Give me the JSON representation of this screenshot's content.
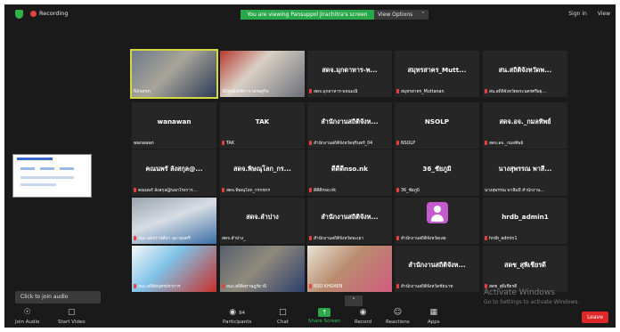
{
  "topbar": {
    "recording_label": "Recording",
    "viewing_banner": "You are viewing Pansuppol Jirachitra's screen",
    "view_options_label": "View Options",
    "view_options_chevron": "˅",
    "sign_in_label": "Sign in",
    "view_label": "View"
  },
  "tiles": [
    {
      "big": "",
      "label": "Ninaron",
      "has_mic_icon": false
    },
    {
      "big": "",
      "label": "30ศูนย์สถิติการ เศรษฐกิจ",
      "has_mic_icon": false
    },
    {
      "big": "สดจ.มุกดาหาร-พ...",
      "label": "สดจ.มุกดาหาร-พจนมณี",
      "has_mic_icon": true
    },
    {
      "big": "สมุทรสาคร_Mutt...",
      "label": "สมุทรสาคร_Muttanan",
      "has_mic_icon": true
    },
    {
      "big": "สน.สถิติจังหวัดพ...",
      "label": "สน.สถิติจังหวัดพระนครศรีอยุ...",
      "has_mic_icon": true
    },
    {
      "big": "wanawan",
      "label": "wanawan",
      "has_mic_icon": false
    },
    {
      "big": "TAK",
      "label": "TAK",
      "has_mic_icon": true
    },
    {
      "big": "สำนักงานสถิติจังห...",
      "label": "สำนักงานสถิติจังหวัดสุรินทร์_04",
      "has_mic_icon": true
    },
    {
      "big": "NSOLP",
      "label": "NSOLP",
      "has_mic_icon": true
    },
    {
      "big": "สดจ.อจ._กมลทิพย์",
      "label": "สดจ.อจ._กมลทิพย์",
      "has_mic_icon": true
    },
    {
      "big": "คณนพรั ลังสกุล@...",
      "label": "คณนพรั ลังสกุล@บอกโรงการ...",
      "has_mic_icon": true
    },
    {
      "big": "สดจ.พิษณุโลก_กร...",
      "label": "สดจ.พิษณุโลก_กรกชกร",
      "has_mic_icon": true
    },
    {
      "big": "ดีดีดีnso.nk",
      "label": "ดีดีดีnso.nk",
      "has_mic_icon": true
    },
    {
      "big": "36_ชัยภูมิ",
      "label": "36_ชัยภูมิ",
      "has_mic_icon": true
    },
    {
      "big": "นางสุพรรณ พาสี...",
      "label": "นางสุพรรณ พาสีมมี สำนักงาน...",
      "has_mic_icon": false
    },
    {
      "big": "",
      "label": "สนง.นครราชสีมา อุมาสุนทรี",
      "has_mic_icon": true
    },
    {
      "big": "สดจ.ลำปาง",
      "label": "สดจ.ลำปาง_",
      "has_mic_icon": false
    },
    {
      "big": "สำนักงานสถิติจังห...",
      "label": "สำนักงานสถิติจังหวัดพะเยา",
      "has_mic_icon": true
    },
    {
      "big": "",
      "label": "สำนักงานสถิติจังหวัดเลย",
      "has_mic_icon": true
    },
    {
      "big": "hrdb_admin1",
      "label": "hrdb_admin1",
      "has_mic_icon": true
    },
    {
      "big": "",
      "label": "สนง.สถิติสมุทรปราการ",
      "has_mic_icon": true
    },
    {
      "big": "",
      "label": "สนง.สถิติสุราษฎร์ธานี",
      "has_mic_icon": true
    },
    {
      "big": "",
      "label": "NSO KHOAEN",
      "has_mic_icon": true
    },
    {
      "big": "สำนักงานสถิติจังห...",
      "label": "สำนักงานสถิติจังหวัดชัยนาท",
      "has_mic_icon": true
    },
    {
      "big": "สดช_สุพิเชียรดี",
      "label": "สดช_สุพิเชียรดี",
      "has_mic_icon": true
    }
  ],
  "toast": "Click to join audio",
  "scroll_chevron": "˅",
  "toolbar": {
    "join_audio": "Join Audio",
    "start_video": "Start Video",
    "participants": "Participants",
    "participant_count": "94",
    "chat": "Chat",
    "share_screen": "Share Screen",
    "record": "Record",
    "reactions": "Reactions",
    "apps": "Apps",
    "leave": "Leave"
  },
  "watermark": {
    "line1": "Activate Windows",
    "line2": "Go to Settings to activate Windows."
  },
  "colors": {
    "background": "#1a1a1a",
    "tile": "#262626",
    "active_speaker": "#d6d842",
    "share_green": "#29a84a",
    "leave_red": "#e02828",
    "mute_red": "#e8403f"
  },
  "icons": {
    "shield": "shield-icon",
    "recording": "recording-dot-icon",
    "headphones": "headphones-icon",
    "camera_off": "camera-off-icon",
    "participants": "participants-icon",
    "chat": "chat-icon",
    "share": "share-screen-icon",
    "record": "record-icon",
    "reactions": "reactions-icon",
    "apps": "apps-icon",
    "mic_muted": "mic-muted-icon",
    "chevron": "chevron-down-icon"
  }
}
